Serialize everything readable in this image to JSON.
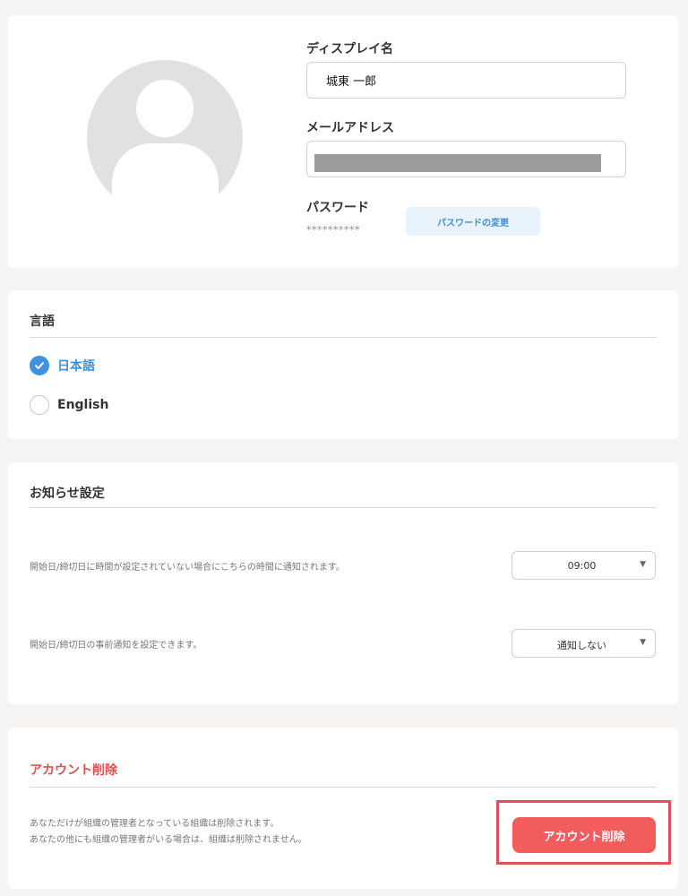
{
  "profile": {
    "display_name_label": "ディスプレイ名",
    "display_name_value": "城東 一郎",
    "email_label": "メールアドレス",
    "email_value": "",
    "password_label": "パスワード",
    "password_mask": "**********",
    "change_password_label": "パスワードの変更"
  },
  "language": {
    "title": "言語",
    "options": [
      {
        "label": "日本語",
        "selected": true
      },
      {
        "label": "English",
        "selected": false
      }
    ]
  },
  "notification": {
    "title": "お知らせ設定",
    "time_description": "開始日/締切日に時間が設定されていない場合にこちらの時間に通知されます。",
    "time_value": "09:00",
    "advance_description": "開始日/締切日の事前通知を設定できます。",
    "advance_value": "通知しない"
  },
  "account_delete": {
    "title": "アカウント削除",
    "description_line1": "あなただけが組織の管理者となっている組織は削除されます。",
    "description_line2": "あなたの他にも組織の管理者がいる場合は、組織は削除されません。",
    "button_label": "アカウント削除"
  },
  "colors": {
    "accent": "#3d93e2",
    "danger": "#f25c5c",
    "highlight": "#e2505f"
  }
}
